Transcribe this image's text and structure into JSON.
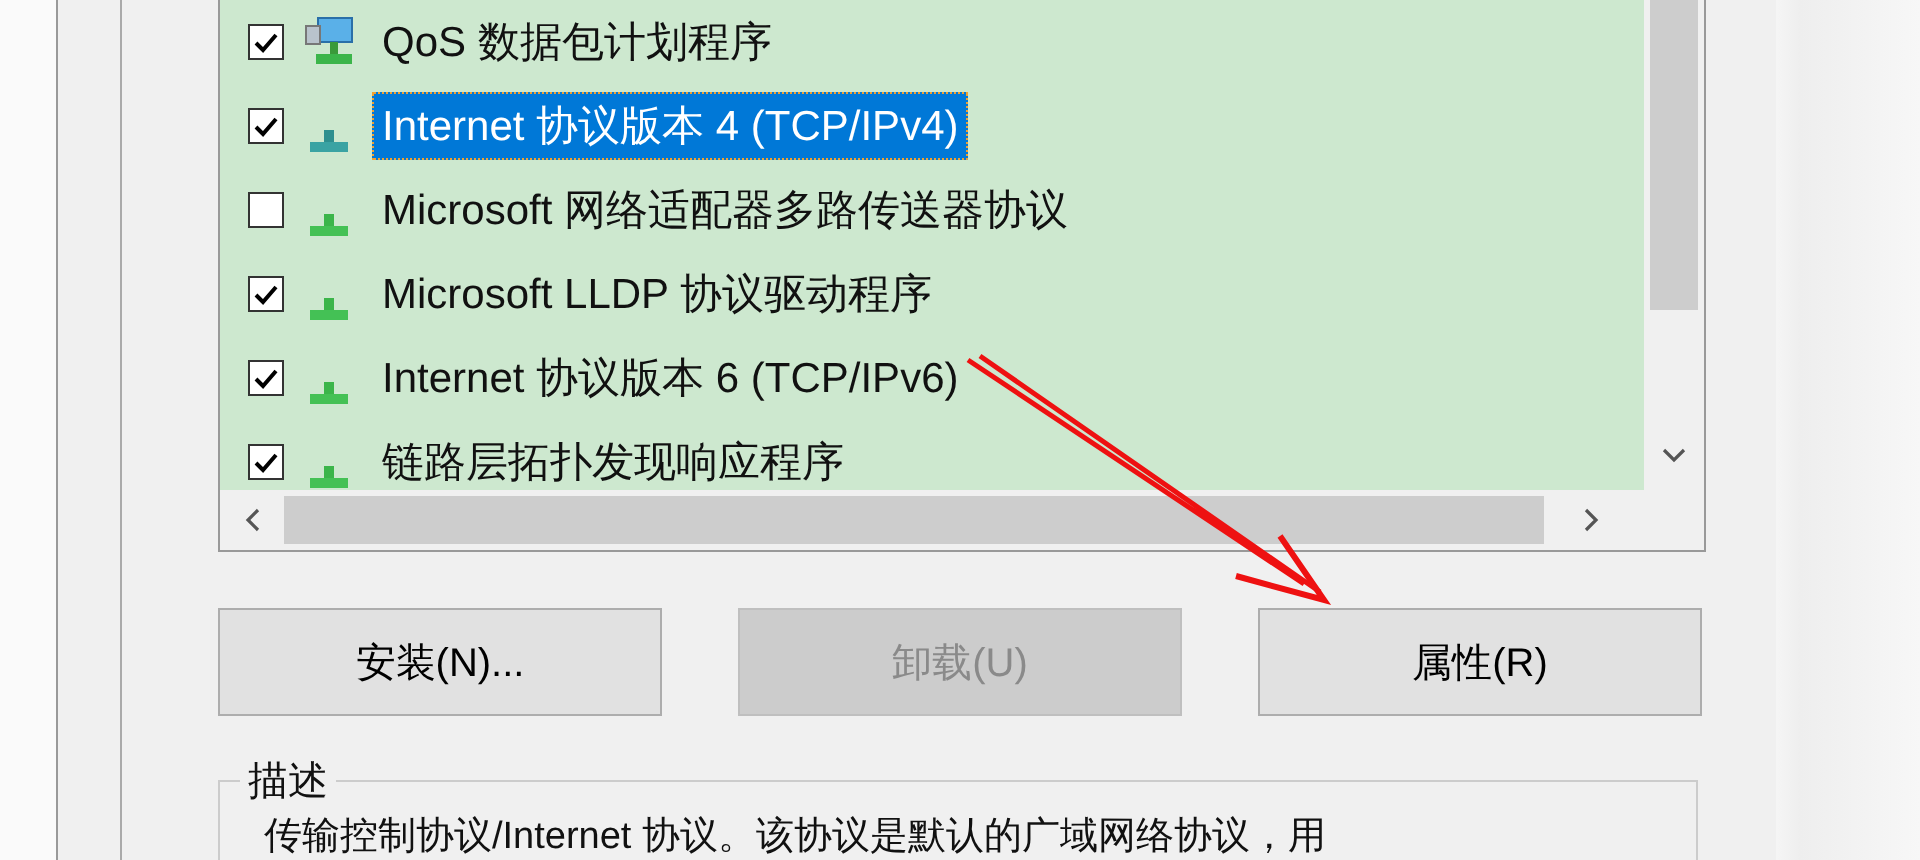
{
  "components": [
    {
      "label": "QoS 数据包计划程序",
      "checked": true,
      "selected": false,
      "kind": "service"
    },
    {
      "label": "Internet 协议版本 4 (TCP/IPv4)",
      "checked": true,
      "selected": true,
      "kind": "protocol"
    },
    {
      "label": "Microsoft 网络适配器多路传送器协议",
      "checked": false,
      "selected": false,
      "kind": "protocol"
    },
    {
      "label": "Microsoft LLDP 协议驱动程序",
      "checked": true,
      "selected": false,
      "kind": "protocol"
    },
    {
      "label": "Internet 协议版本 6 (TCP/IPv6)",
      "checked": true,
      "selected": false,
      "kind": "protocol"
    },
    {
      "label": "链路层拓扑发现响应程序",
      "checked": true,
      "selected": false,
      "kind": "protocol"
    }
  ],
  "buttons": [
    {
      "label": "安装(N)...",
      "disabled": false
    },
    {
      "label": "卸载(U)",
      "disabled": true
    },
    {
      "label": "属性(R)",
      "disabled": false
    }
  ],
  "description": {
    "title": "描述",
    "text": "传输控制协议/Internet 协议。该协议是默认的广域网络协议，用"
  }
}
